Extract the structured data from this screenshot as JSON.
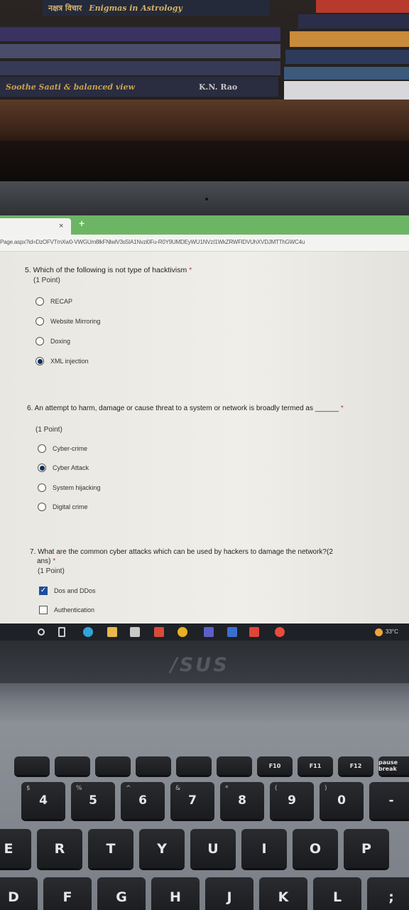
{
  "browser": {
    "tab_close": "×",
    "tab_add": "+",
    "url": "Page.aspx?id=DzOFVTmXw0-VWGUm8lkFNlwlV3s5IA1Nvzi0Fu-R0Y9UMDEyWU1NVzI1WkZRWFlDVUhXVDJMTThGWC4u"
  },
  "form": {
    "required_mark": "*",
    "questions": [
      {
        "title": "5. Which of the following is not type of hacktivism",
        "points": "(1 Point)",
        "options": [
          {
            "label": "RECAP",
            "selected": false
          },
          {
            "label": "Website Mirroring",
            "selected": false
          },
          {
            "label": "Doxing",
            "selected": false
          },
          {
            "label": "XML injection",
            "selected": true
          }
        ]
      },
      {
        "title": "6. An attempt to harm, damage or cause threat to a system or network is broadly termed as ______",
        "points": "(1 Point)",
        "options": [
          {
            "label": "Cyber-crime",
            "selected": false
          },
          {
            "label": "Cyber Attack",
            "selected": true
          },
          {
            "label": "System hijacking",
            "selected": false
          },
          {
            "label": "Digital crime",
            "selected": false
          }
        ]
      },
      {
        "title_line1": "7. What are the common cyber attacks which can be used by hackers to damage the network?(2",
        "title_line2": "ans)",
        "points": "(1 Point)",
        "options": [
          {
            "label": "Dos and DDos",
            "selected": true
          },
          {
            "label": "Authentication",
            "selected": false
          }
        ]
      }
    ]
  },
  "taskbar": {
    "temperature": "33°C"
  },
  "laptop": {
    "brand": "/SUS"
  },
  "keyboard": {
    "fn_row": [
      "",
      "",
      "",
      "",
      "",
      "",
      "F10",
      "F11",
      "F12",
      "pause break"
    ],
    "number_row": [
      "4",
      "5",
      "6",
      "7",
      "8",
      "9",
      "0",
      "-"
    ],
    "number_row_sub": [
      "$",
      "%",
      "^",
      "&",
      "*",
      "(",
      ")",
      ""
    ],
    "top_row": [
      "E",
      "R",
      "T",
      "Y",
      "U",
      "I",
      "O",
      "P"
    ],
    "home_row": [
      "D",
      "F",
      "G",
      "H",
      "J",
      "K",
      "L",
      ";"
    ]
  },
  "books": [
    "नक्षत्र विचार",
    "Enigmas in Astrology",
    "Soothe Saati & balanced view",
    "K.N. Rao"
  ],
  "colors": {
    "tabbar": "#6cb565",
    "selected_radio": "#0f2d5c",
    "checkbox": "#1b4f9c",
    "taskbar": "#1e2126"
  }
}
